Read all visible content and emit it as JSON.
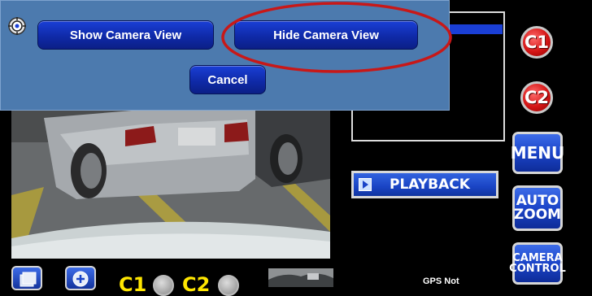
{
  "popup": {
    "show_camera_view": "Show Camera View",
    "hide_camera_view": "Hide Camera View",
    "cancel": "Cancel"
  },
  "side_buttons": {
    "c1": "C1",
    "c2": "C2",
    "menu": "MENU",
    "auto_zoom_line1": "AUTO",
    "auto_zoom_line2": "ZOOM",
    "camera_control_line1": "CAMERA",
    "camera_control_line2": "CONTROL"
  },
  "playback": {
    "label": "PLAYBACK"
  },
  "bottom_bar": {
    "c1_label": "C1",
    "c2_label": "C2",
    "gps_text": "GPS Not"
  },
  "colors": {
    "popup_background": "#4c7aae",
    "button_blue": "#1a3fd6",
    "annotation_red": "#c81818",
    "camera_label_yellow": "#ffe600"
  },
  "icons": {
    "target": "crosshair-target-icon",
    "play": "play-icon",
    "snapshot": "snapshot-icon",
    "zoom_in": "zoom-in-icon"
  }
}
